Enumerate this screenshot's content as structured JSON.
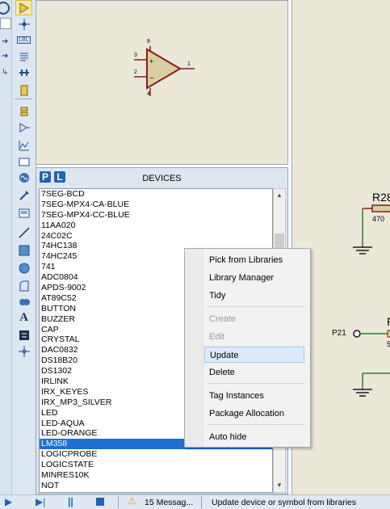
{
  "toolbar": {
    "icons": [
      "selection-icon",
      "component-icon",
      "junction-icon",
      "wire-label-icon",
      "text-script-icon",
      "bus-icon",
      "subcircuit-icon",
      "terminal-icon",
      "device-pin-icon",
      "graph-icon",
      "tape-icon",
      "generator-icon",
      "probe-icon",
      "virtual-instrument-icon",
      "line-icon",
      "box-icon",
      "circle-icon",
      "arc-icon",
      "path-icon",
      "text-icon",
      "symbol-icon",
      "marker-icon"
    ]
  },
  "preview": {
    "component": "op-amp",
    "pin_labels": [
      "8",
      "3",
      "2",
      "1",
      "4"
    ]
  },
  "devices_panel": {
    "p_button": "P",
    "l_button": "L",
    "title": "DEVICES",
    "items": [
      "7SEG-BCD",
      "7SEG-MPX4-CA-BLUE",
      "7SEG-MPX4-CC-BLUE",
      "11AA020",
      "24C02C",
      "74HC138",
      "74HC245",
      "741",
      "ADC0804",
      "APDS-9002",
      "AT89C52",
      "BUTTON",
      "BUZZER",
      "CAP",
      "CRYSTAL",
      "DAC0832",
      "DS18B20",
      "DS1302",
      "IRLINK",
      "IRX_KEYES",
      "IRX_MP3_SILVER",
      "LED",
      "LED-AQUA",
      "LED-ORANGE",
      "LM358",
      "LOGICPROBE",
      "LOGICSTATE",
      "MINRES10K",
      "NOT"
    ],
    "selected_index": 24
  },
  "schematic": {
    "ref": "R28",
    "value": "470",
    "terminal": "P21",
    "partial_letter": "P",
    "partial_digit": "5"
  },
  "context_menu": {
    "items": [
      {
        "label": "Pick from Libraries",
        "disabled": false
      },
      {
        "label": "Library Manager",
        "disabled": false
      },
      {
        "label": "Tidy",
        "disabled": false
      },
      {
        "label": "Create",
        "disabled": true
      },
      {
        "label": "Edit",
        "disabled": true
      },
      {
        "label": "Update",
        "disabled": false,
        "hover": true
      },
      {
        "label": "Delete",
        "disabled": false
      },
      {
        "label": "Tag Instances",
        "disabled": false
      },
      {
        "label": "Package Allocation",
        "disabled": false
      },
      {
        "label": "Auto hide",
        "disabled": false
      }
    ]
  },
  "statusbar": {
    "messages": "15 Messag...",
    "hint": "Update device or symbol from libraries"
  },
  "colors": {
    "selection": "#1e6fd0",
    "component_outline": "#8b1a1a",
    "component_fill": "#d8cfa0",
    "sheet_bg": "#ebe8d8"
  }
}
